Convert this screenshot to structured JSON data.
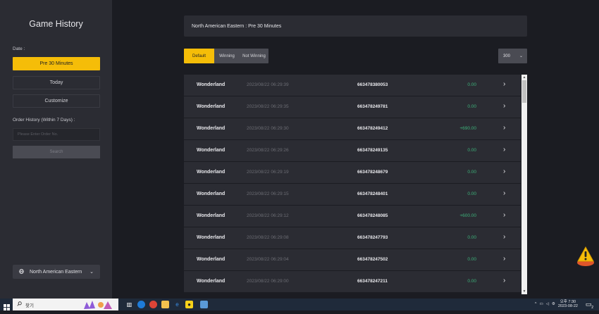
{
  "sidebar": {
    "title": "Game History",
    "date_label": "Date :",
    "date_options": [
      "Pre 30 Minutes",
      "Today",
      "Customize"
    ],
    "order_history_label": "Order History (Within 7 Days) :",
    "order_input_placeholder": "Please Enter Order No.",
    "search_label": "Search",
    "region_label": "North American Eastern"
  },
  "header": {
    "title": "North American Eastern : Pre 30 Minutes"
  },
  "filters": {
    "default_label": "Default",
    "winning_label": "Winning",
    "not_winning_label": "Not Winning",
    "page_size": "300"
  },
  "rows": [
    {
      "game": "Wonderland",
      "time": "2023/08/22 06:29:39",
      "order": "663478380053",
      "amount": "0.00"
    },
    {
      "game": "Wonderland",
      "time": "2023/08/22 06:29:35",
      "order": "663478249781",
      "amount": "0.00"
    },
    {
      "game": "Wonderland",
      "time": "2023/08/22 06:29:30",
      "order": "663478249412",
      "amount": "+690.00"
    },
    {
      "game": "Wonderland",
      "time": "2023/08/22 06:29:26",
      "order": "663478249135",
      "amount": "0.00"
    },
    {
      "game": "Wonderland",
      "time": "2023/08/22 06:29:19",
      "order": "663478248679",
      "amount": "0.00"
    },
    {
      "game": "Wonderland",
      "time": "2023/08/22 06:29:15",
      "order": "663478248401",
      "amount": "0.00"
    },
    {
      "game": "Wonderland",
      "time": "2023/08/22 06:29:12",
      "order": "663478248085",
      "amount": "+600.00"
    },
    {
      "game": "Wonderland",
      "time": "2023/08/22 06:29:08",
      "order": "663478247793",
      "amount": "0.00"
    },
    {
      "game": "Wonderland",
      "time": "2023/08/22 06:29:04",
      "order": "663478247502",
      "amount": "0.00"
    },
    {
      "game": "Wonderland",
      "time": "2023/08/22 06:29:00",
      "order": "663478247211",
      "amount": "0.00"
    }
  ],
  "taskbar": {
    "search_placeholder": "찾기",
    "time": "오후 7:30",
    "date": "2023-08-22",
    "notification_count": "2"
  },
  "colors": {
    "accent": "#f5bd08",
    "win_green": "#3db27a",
    "panel": "#2b2c33",
    "background": "#1b1c22"
  }
}
